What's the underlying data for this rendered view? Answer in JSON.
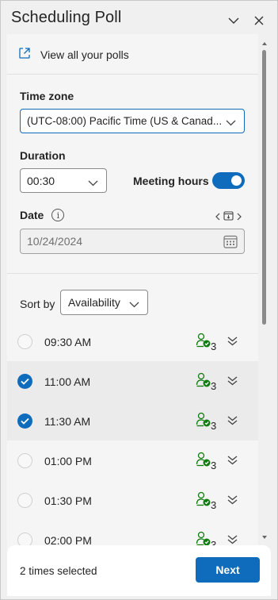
{
  "header": {
    "title": "Scheduling Poll"
  },
  "view_all": {
    "label": "View all your polls"
  },
  "time_zone": {
    "label": "Time zone",
    "value": "(UTC-08:00) Pacific Time (US & Canad..."
  },
  "duration": {
    "label": "Duration",
    "value": "00:30"
  },
  "meeting_hours": {
    "label": "Meeting hours",
    "enabled": true
  },
  "date": {
    "label": "Date",
    "value": "10/24/2024"
  },
  "sort": {
    "label": "Sort by",
    "value": "Availability"
  },
  "times": [
    {
      "time": "09:30 AM",
      "selected": false,
      "count": "3"
    },
    {
      "time": "11:00 AM",
      "selected": true,
      "count": "3"
    },
    {
      "time": "11:30 AM",
      "selected": true,
      "count": "3"
    },
    {
      "time": "01:00 PM",
      "selected": false,
      "count": "3"
    },
    {
      "time": "01:30 PM",
      "selected": false,
      "count": "3"
    },
    {
      "time": "02:00 PM",
      "selected": false,
      "count": "3"
    }
  ],
  "footer": {
    "selected_text": "2 times selected",
    "next_label": "Next"
  },
  "colors": {
    "accent": "#0f6cbd",
    "available": "#107c10"
  }
}
